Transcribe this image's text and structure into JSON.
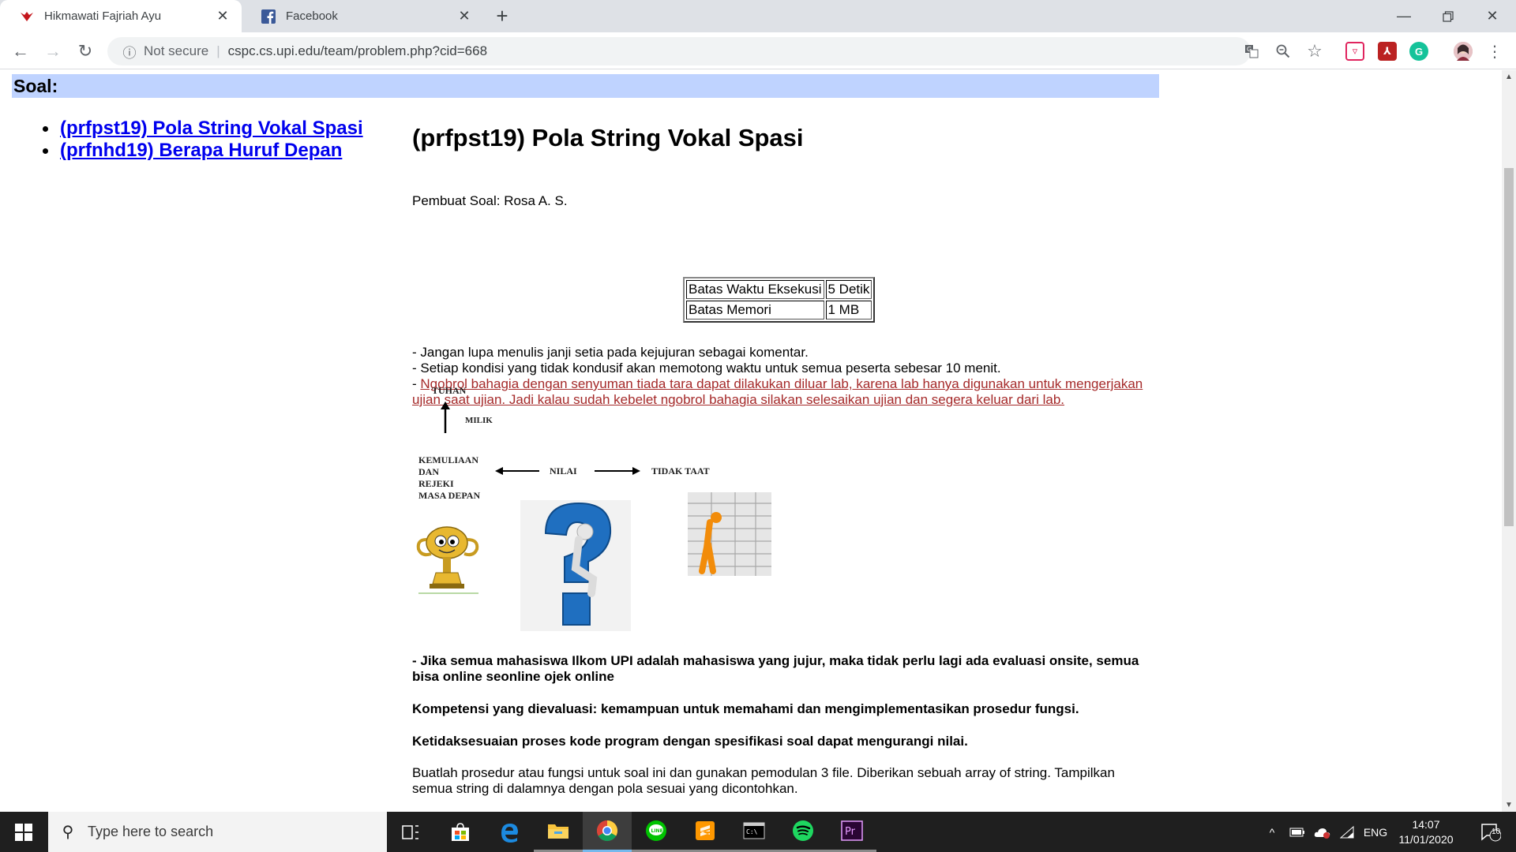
{
  "browser": {
    "tabs": [
      {
        "title": "Hikmawati Fajriah Ayu",
        "active": true,
        "favicon": "red-bird-icon"
      },
      {
        "title": "Facebook",
        "active": false,
        "favicon": "facebook-icon"
      }
    ],
    "new_tab_symbol": "+",
    "address": {
      "security_label": "Not secure",
      "url": "cspc.cs.upi.edu/team/problem.php?cid=668"
    }
  },
  "page": {
    "soal_heading": "Soal:",
    "problems": [
      {
        "label": "(prfpst19) Pola String Vokal Spasi"
      },
      {
        "label": "(prfnhd19) Berapa Huruf Depan"
      }
    ],
    "problem_title": "(prfpst19) Pola String Vokal Spasi",
    "author": "Pembuat Soal: Rosa A. S.",
    "limits": [
      {
        "name": "Batas Waktu Eksekusi",
        "value": "5 Detik"
      },
      {
        "name": "Batas Memori",
        "value": "1 MB"
      }
    ],
    "rules": {
      "line1": "- Jangan lupa menulis janji setia pada kejujuran sebagai komentar.",
      "line2": "- Setiap kondisi yang tidak kondusif akan memotong waktu untuk semua peserta sebesar 10 menit.",
      "line3_prefix": "- ",
      "line3_link": "Ngobrol bahagia dengan senyuman tiada tara dapat dilakukan diluar lab, karena lab hanya digunakan untuk mengerjakan ujian saat ujian. Jadi kalau sudah kebelet ngobrol bahagia silakan selesaikan ujian dan segera keluar dari lab."
    },
    "diagram": {
      "top": "TUHAN",
      "arrow_label": "MILIK",
      "left": "KEMULIAAN DAN REJEKI MASA DEPAN",
      "left_lines": [
        "KEMULIAAN",
        "DAN",
        "REJEKI",
        "MASA DEPAN"
      ],
      "center": "NILAI",
      "right": "TIDAK TAAT"
    },
    "bold_paragraphs": [
      "- Jika semua mahasiswa Ilkom UPI adalah mahasiswa yang jujur, maka tidak perlu lagi ada evaluasi onsite, semua bisa online seonline ojek online",
      "Kompetensi yang dievaluasi: kemampuan untuk memahami dan mengimplementasikan prosedur fungsi.",
      "Ketidaksesuaian proses kode program dengan spesifikasi soal dapat mengurangi nilai."
    ],
    "description": "Buatlah prosedur atau fungsi untuk soal ini dan gunakan pemodulan 3 file. Diberikan sebuah array of string. Tampilkan semua string di dalamnya dengan pola sesuai yang dicontohkan."
  },
  "taskbar": {
    "search_placeholder": "Type here to search",
    "language": "ENG",
    "time": "14:07",
    "date": "11/01/2020",
    "notification_count": "10"
  },
  "colors": {
    "soal_bar": "#bfd3ff",
    "link": "#0000ee",
    "rule_red": "#a52a2a"
  }
}
